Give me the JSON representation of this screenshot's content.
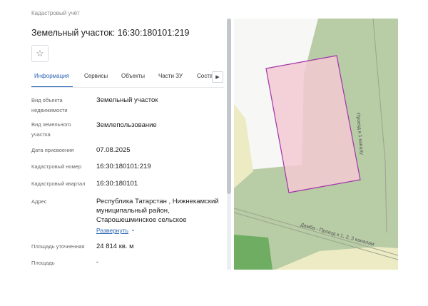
{
  "breadcrumb": "Кадастровый учёт",
  "title": "Земельный участок: 16:30:180101:219",
  "star_icon": "☆",
  "tabs": [
    {
      "label": "Информация",
      "active": true
    },
    {
      "label": "Сервисы",
      "active": false
    },
    {
      "label": "Объекты",
      "active": false
    },
    {
      "label": "Части ЗУ",
      "active": false
    },
    {
      "label": "Состав",
      "active": false
    }
  ],
  "tab_next_icon": "▶",
  "fields": [
    {
      "label": "Вид объекта недвижимости",
      "value": "Земельный участок"
    },
    {
      "label": "Вид земельного участка",
      "value": "Землепользование"
    },
    {
      "label": "Дата присвоения",
      "value": "07.08.2025"
    },
    {
      "label": "Кадастровый номер",
      "value": "16:30:180101:219"
    },
    {
      "label": "Кадастровый квартал",
      "value": "16:30:180101"
    },
    {
      "label": "Адрес",
      "value": "Республика Татарстан , Нижнекамский муниципальный район, Старошешминское сельское"
    },
    {
      "label": "Площадь уточненная",
      "value": "24 814 кв. м"
    },
    {
      "label": "Площадь",
      "value": "-"
    }
  ],
  "expand_label": "Развернуть",
  "expand_icon": "⌄",
  "map": {
    "road_label_1": "Проезд к 1 каналу",
    "road_label_2": "Дамба - Проезд к 1, 2, 3 каналам",
    "colors": {
      "green_area": "#b8cca5",
      "white_area": "#f7f7f5",
      "yellow_area": "#ecebc4",
      "dark_green": "#6fad62",
      "parcel_fill": "#f3c9d2",
      "parcel_border": "#a036a8"
    }
  }
}
